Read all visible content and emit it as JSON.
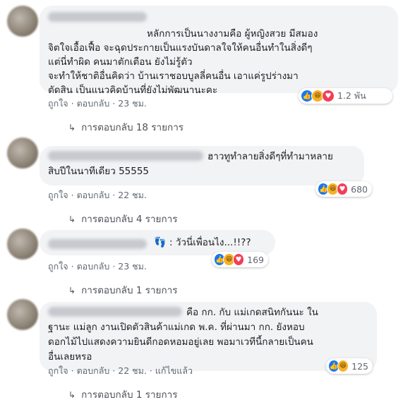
{
  "comments": [
    {
      "text_lines": [
        "หลักการเป็นนางงามคือ ผู้หญิงสวย มีสมอง",
        "จิตใจเอื้อเฟื้อ จะฉุดประกายเป็นแรงบันดาลใจให้คนอื่นทำในสิ่งดีๆ",
        "แต่นี่ทำผิด คนมาตักเตือน ยังไม่รู้ตัว",
        "จะทำให้ชาติอื่นคิดว่า บ้านเราชอบบูลลี่คนอื่น เอาแค่รูปร่างมา",
        "ตัดสิน เป็นแนวคิดบ้านที่ยังไม่พัฒนานะคะ"
      ],
      "reaction_count": "1.2 พัน",
      "like_label": "ถูกใจ",
      "reply_label": "ตอบกลับ",
      "time": "23 ชม.",
      "replies_label": "การตอบกลับ 18 รายการ"
    },
    {
      "text_lines": [
        "ฮาวทูทำลายสิ่งดีๆที่ทำมาหลาย",
        "สิบปีในนาทีเดียว 55555"
      ],
      "reaction_count": "680",
      "like_label": "ถูกใจ",
      "reply_label": "ตอบกลับ",
      "time": "22 ชม.",
      "replies_label": "การตอบกลับ 4 รายการ"
    },
    {
      "text_lines": [
        ": วัวนี่เพื่อนไง...!!??"
      ],
      "emoji": "👣",
      "reaction_count": "169",
      "like_label": "ถูกใจ",
      "reply_label": "ตอบกลับ",
      "time": "23 ชม.",
      "replies_label": "การตอบกลับ 1 รายการ"
    },
    {
      "text_lines": [
        "คือ กก. กับ แม่เกดสนิทกันนะ ใน",
        "ฐานะ แม่ลูก งานเปิดตัวสินค้าแม่เกด พ.ค. ที่ผ่านมา กก. ยังหอบ",
        "ดอกไม้ไปแสดงความยินดีกอดหอมอยู่เลย พอมาเวทีนี้กลายเป็นคน",
        "อื่นเลยหรอ"
      ],
      "reaction_count": "125",
      "like_label": "ถูกใจ",
      "reply_label": "ตอบกลับ",
      "time": "22 ชม.",
      "edited_label": "แก้ไขแล้ว",
      "replies_label": "การตอบกลับ 1 รายการ"
    }
  ]
}
